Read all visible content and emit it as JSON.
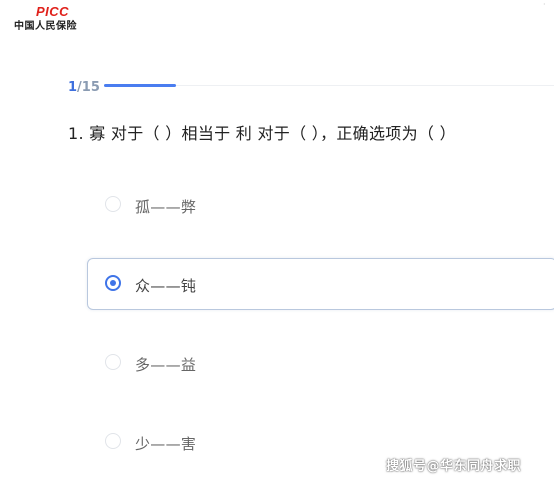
{
  "logo": {
    "mark": "PICC",
    "text": "中国人民保险"
  },
  "progress": {
    "current": "1",
    "total": "/15",
    "fraction": 0.16
  },
  "question": {
    "text": "1. 寡 对于（ ）相当于 利 对于（ ），正确选项为（ ）"
  },
  "options": [
    {
      "label": "孤——弊",
      "selected": false
    },
    {
      "label": "众——钝",
      "selected": true
    },
    {
      "label": "多——益",
      "selected": false
    },
    {
      "label": "少——害",
      "selected": false
    }
  ],
  "watermark": "搜狐号@华东同舟求职",
  "colors": {
    "accent": "#3f74e8",
    "brand_red": "#e0211b"
  }
}
